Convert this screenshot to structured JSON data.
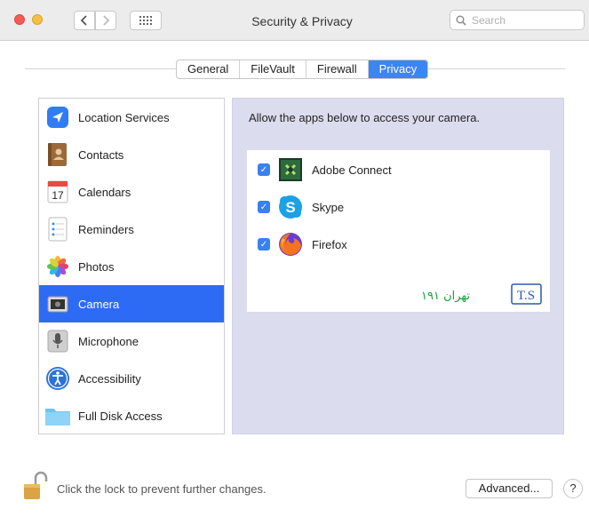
{
  "window": {
    "title": "Security & Privacy",
    "search_placeholder": "Search",
    "nav_back_icon": "chevron-left-icon",
    "nav_forward_icon": "chevron-right-icon",
    "show_all_icon": "grid-icon"
  },
  "tabs": [
    {
      "label": "General",
      "active": false
    },
    {
      "label": "FileVault",
      "active": false
    },
    {
      "label": "Firewall",
      "active": false
    },
    {
      "label": "Privacy",
      "active": true
    }
  ],
  "sidebar": {
    "items": [
      {
        "label": "Location Services",
        "icon": "location-arrow-icon",
        "active": false
      },
      {
        "label": "Contacts",
        "icon": "contacts-book-icon",
        "active": false
      },
      {
        "label": "Calendars",
        "icon": "calendar-icon",
        "active": false,
        "icon_text": "17"
      },
      {
        "label": "Reminders",
        "icon": "reminders-list-icon",
        "active": false
      },
      {
        "label": "Photos",
        "icon": "photos-flower-icon",
        "active": false
      },
      {
        "label": "Camera",
        "icon": "camera-icon",
        "active": true
      },
      {
        "label": "Microphone",
        "icon": "microphone-icon",
        "active": false
      },
      {
        "label": "Accessibility",
        "icon": "accessibility-icon",
        "active": false
      },
      {
        "label": "Full Disk Access",
        "icon": "folder-icon",
        "active": false
      }
    ]
  },
  "main": {
    "header": "Allow the apps below to access your camera.",
    "apps": [
      {
        "label": "Adobe Connect",
        "icon": "adobe-connect-icon",
        "checked": true
      },
      {
        "label": "Skype",
        "icon": "skype-icon",
        "checked": true
      },
      {
        "label": "Firefox",
        "icon": "firefox-icon",
        "checked": true
      }
    ]
  },
  "watermark": {
    "ts": "T.S",
    "text": "تهران ۱۹۱"
  },
  "footer": {
    "lock_text": "Click the lock to prevent further changes.",
    "advanced_label": "Advanced...",
    "help_label": "?"
  },
  "colors": {
    "accent": "#3c85f5",
    "selection": "#2e6bf4",
    "panel_bg": "#dcdcef"
  }
}
